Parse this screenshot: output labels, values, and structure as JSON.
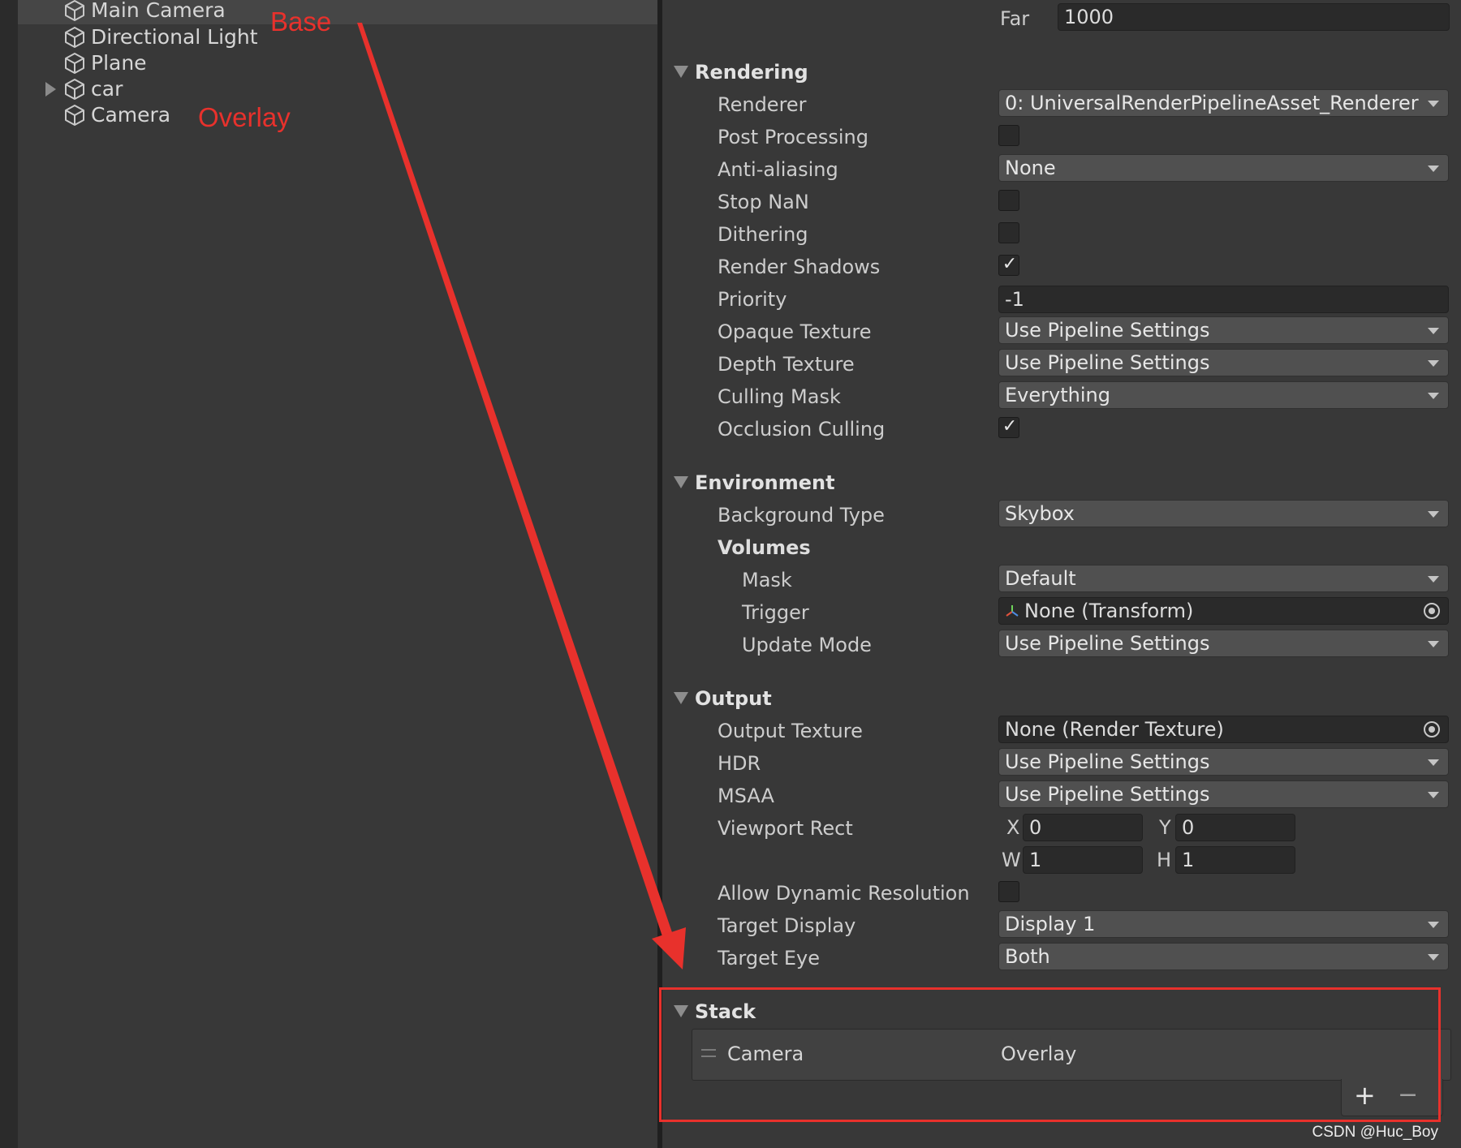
{
  "hierarchy": {
    "items": [
      {
        "label": "Main Camera"
      },
      {
        "label": "Directional Light"
      },
      {
        "label": "Plane"
      },
      {
        "label": "car"
      },
      {
        "label": "Camera"
      }
    ],
    "annotations": {
      "base": "Base",
      "overlay": "Overlay"
    }
  },
  "inspector": {
    "far": {
      "label": "Far",
      "value": "1000"
    },
    "rendering": {
      "header": "Rendering",
      "renderer": {
        "label": "Renderer",
        "value": "0: UniversalRenderPipelineAsset_Renderer"
      },
      "post_processing": {
        "label": "Post Processing",
        "checked": false
      },
      "anti_aliasing": {
        "label": "Anti-aliasing",
        "value": "None"
      },
      "stop_nan": {
        "label": "Stop NaN",
        "checked": false
      },
      "dithering": {
        "label": "Dithering",
        "checked": false
      },
      "render_shadows": {
        "label": "Render Shadows",
        "checked": true
      },
      "priority": {
        "label": "Priority",
        "value": "-1"
      },
      "opaque_texture": {
        "label": "Opaque Texture",
        "value": "Use Pipeline Settings"
      },
      "depth_texture": {
        "label": "Depth Texture",
        "value": "Use Pipeline Settings"
      },
      "culling_mask": {
        "label": "Culling Mask",
        "value": "Everything"
      },
      "occlusion_culling": {
        "label": "Occlusion Culling",
        "checked": true
      }
    },
    "environment": {
      "header": "Environment",
      "background_type": {
        "label": "Background Type",
        "value": "Skybox"
      },
      "volumes_label": "Volumes",
      "mask": {
        "label": "Mask",
        "value": "Default"
      },
      "trigger": {
        "label": "Trigger",
        "value": "None (Transform)"
      },
      "update_mode": {
        "label": "Update Mode",
        "value": "Use Pipeline Settings"
      }
    },
    "output": {
      "header": "Output",
      "output_texture": {
        "label": "Output Texture",
        "value": "None (Render Texture)"
      },
      "hdr": {
        "label": "HDR",
        "value": "Use Pipeline Settings"
      },
      "msaa": {
        "label": "MSAA",
        "value": "Use Pipeline Settings"
      },
      "viewport_rect": {
        "label": "Viewport Rect",
        "x": {
          "label": "X",
          "value": "0"
        },
        "y": {
          "label": "Y",
          "value": "0"
        },
        "w": {
          "label": "W",
          "value": "1"
        },
        "h": {
          "label": "H",
          "value": "1"
        }
      },
      "allow_dynamic_resolution": {
        "label": "Allow Dynamic Resolution",
        "checked": false
      },
      "target_display": {
        "label": "Target Display",
        "value": "Display 1"
      },
      "target_eye": {
        "label": "Target Eye",
        "value": "Both"
      }
    },
    "stack": {
      "header": "Stack",
      "entries": [
        {
          "name": "Camera",
          "type": "Overlay"
        }
      ],
      "add_label": "+",
      "remove_label": "−"
    }
  },
  "colors": {
    "annotation": "#e8312c",
    "panel_bg": "#383838",
    "dropdown_bg": "#505050",
    "field_bg": "#2a2a2a"
  },
  "watermark": "CSDN @Huc_Boy"
}
